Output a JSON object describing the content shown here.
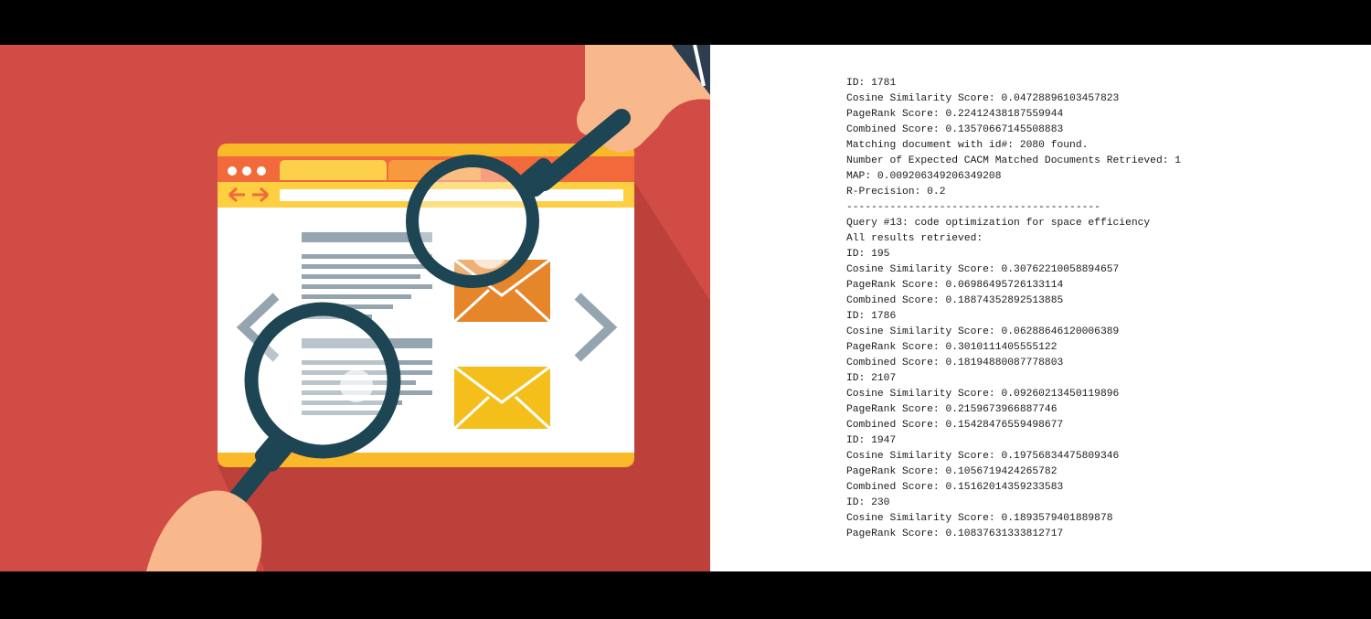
{
  "colors": {
    "background": "#d14c45",
    "shadow": "#b63c37",
    "panel": "#ffffff",
    "text": "#1a1a1a",
    "browser_frame": "#f9b928",
    "tab_bar": "#f26a3b",
    "lens_frame": "#1e4553",
    "hand": "#f8b88c"
  },
  "illustration": {
    "icons": [
      "browser-window-icon",
      "magnifying-glass-icon",
      "envelope-icon",
      "chevron-left-icon",
      "chevron-right-icon",
      "hand-icon"
    ]
  },
  "console": {
    "lines": [
      "ID: 1781",
      "Cosine Similarity Score: 0.04728896103457823",
      "PageRank Score: 0.22412438187559944",
      "Combined Score: 0.13570667145508883",
      "Matching document with id#: 2080 found.",
      "Number of Expected CACM Matched Documents Retrieved: 1",
      "MAP: 0.009206349206349208",
      "R-Precision: 0.2",
      "-----------------------------------------",
      "Query #13: code optimization for space efficiency",
      "All results retrieved:",
      "ID: 195",
      "Cosine Similarity Score: 0.30762210058894657",
      "PageRank Score: 0.06986495726133114",
      "Combined Score: 0.18874352892513885",
      "ID: 1786",
      "Cosine Similarity Score: 0.06288646120006389",
      "PageRank Score: 0.3010111405555122",
      "Combined Score: 0.18194880087778803",
      "ID: 2107",
      "Cosine Similarity Score: 0.09260213450119896",
      "PageRank Score: 0.2159673966887746",
      "Combined Score: 0.15428476559498677",
      "ID: 1947",
      "Cosine Similarity Score: 0.19756834475809346",
      "PageRank Score: 0.1056719424265782",
      "Combined Score: 0.15162014359233583",
      "ID: 230",
      "Cosine Similarity Score: 0.1893579401889878",
      "PageRank Score: 0.10837631333812717"
    ]
  }
}
